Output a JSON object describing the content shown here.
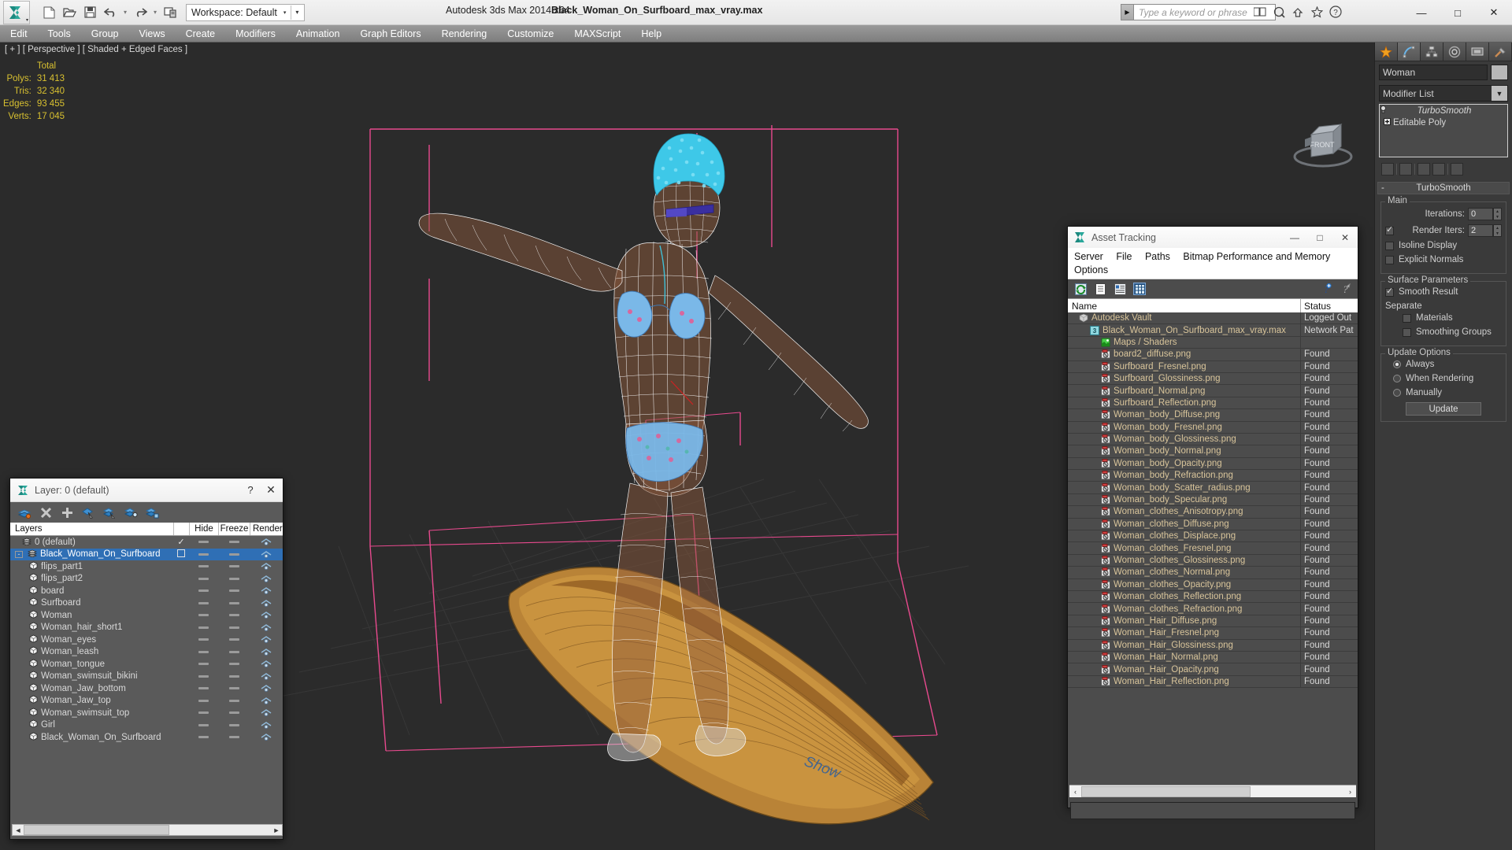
{
  "titlebar": {
    "app_title": "Autodesk 3ds Max  2014 x64",
    "file_title": "Black_Woman_On_Surfboard_max_vray.max",
    "workspace_label": "Workspace: Default",
    "search_placeholder": "Type a keyword or phrase",
    "quick_access": [
      {
        "name": "new-file-icon",
        "glyph": "⬜"
      },
      {
        "name": "open-file-icon",
        "glyph": "Ὄ2"
      },
      {
        "name": "save-file-icon",
        "glyph": "Ὃe"
      },
      {
        "name": "undo-icon",
        "glyph": "↶"
      },
      {
        "name": "redo-icon",
        "glyph": "↷"
      },
      {
        "name": "project-folder-icon",
        "glyph": "὜2"
      }
    ],
    "window_buttons": {
      "minimize": "—",
      "maximize": "□",
      "close": "✕"
    }
  },
  "menubar": {
    "items": [
      "Edit",
      "Tools",
      "Group",
      "Views",
      "Create",
      "Modifiers",
      "Animation",
      "Graph Editors",
      "Rendering",
      "Customize",
      "MAXScript",
      "Help"
    ]
  },
  "viewport": {
    "label": "[ + ] [ Perspective ] [ Shaded + Edged Faces ]",
    "stats_header": "Total",
    "stats": [
      {
        "label": "Polys:",
        "value": "31 413"
      },
      {
        "label": "Tris:",
        "value": "32 340"
      },
      {
        "label": "Edges:",
        "value": "93 455"
      },
      {
        "label": "Verts:",
        "value": "17 045"
      }
    ],
    "viewcube_face": "FRONT",
    "background_color": "#2b2b2b",
    "wireframe_color": "#ffffff",
    "helper_color": "#e84a8e",
    "surfboard_colors": [
      "#c8913f",
      "#a9702c",
      "#8d5a22"
    ],
    "skin_color": "#8d5a3c",
    "hair_color": "#36c8e8",
    "board_logo": "Show"
  },
  "command_panel": {
    "tabs": [
      {
        "name": "create-tab",
        "icon": "star-icon",
        "active": false
      },
      {
        "name": "modify-tab",
        "icon": "curve-icon",
        "active": true
      },
      {
        "name": "hierarchy-tab",
        "icon": "hierarchy-icon",
        "active": false
      },
      {
        "name": "motion-tab",
        "icon": "motion-icon",
        "active": false
      },
      {
        "name": "display-tab",
        "icon": "display-icon",
        "active": false
      },
      {
        "name": "utilities-tab",
        "icon": "hammer-icon",
        "active": false
      }
    ],
    "object_name": "Woman",
    "object_color": "#b8b8b8",
    "modifier_list_label": "Modifier List",
    "modifier_stack": [
      {
        "label": "TurboSmooth",
        "italic": true,
        "icon": "lightbulb-icon"
      },
      {
        "label": "Editable Poly",
        "italic": false,
        "icon": "plus-box-icon"
      }
    ],
    "rollout": {
      "title": "TurboSmooth",
      "minus": "-",
      "groups": [
        {
          "title": "Main",
          "fields": [
            {
              "type": "spinner",
              "label": "Iterations:",
              "value": "0"
            },
            {
              "type": "checkbox_spinner",
              "label": "Render Iters:",
              "value": "2",
              "checked": true
            },
            {
              "type": "checkbox",
              "label": "Isoline Display",
              "checked": false
            },
            {
              "type": "checkbox",
              "label": "Explicit Normals",
              "checked": false
            }
          ]
        },
        {
          "title": "Surface Parameters",
          "fields": [
            {
              "type": "checkbox",
              "label": "Smooth Result",
              "checked": true
            },
            {
              "type": "text",
              "label": "Separate"
            },
            {
              "type": "checkbox_indent",
              "label": "Materials",
              "checked": false
            },
            {
              "type": "checkbox_indent",
              "label": "Smoothing Groups",
              "checked": false
            }
          ]
        },
        {
          "title": "Update Options",
          "fields": [
            {
              "type": "radio",
              "label": "Always",
              "checked": true
            },
            {
              "type": "radio",
              "label": "When Rendering",
              "checked": false
            },
            {
              "type": "radio",
              "label": "Manually",
              "checked": false
            },
            {
              "type": "button",
              "label": "Update"
            }
          ]
        }
      ]
    }
  },
  "layer_dialog": {
    "title": "Layer: 0 (default)",
    "help_glyph": "?",
    "close_glyph": "✕",
    "toolbar_icons": [
      "create-new-layer-icon",
      "delete-layer-icon",
      "add-layer-icon",
      "select-objects-icon",
      "select-highlighted-icon",
      "highlight-selected-icon",
      "layer-properties-icon"
    ],
    "columns": [
      "Layers",
      "",
      "Hide",
      "Freeze",
      "Render"
    ],
    "rows": [
      {
        "label": "0 (default)",
        "indent": 1,
        "icon": "layer-icon",
        "selected": false,
        "check": true,
        "box": false
      },
      {
        "label": "Black_Woman_On_Surfboard",
        "indent": 0,
        "icon": "layer-icon",
        "selected": true,
        "check": false,
        "box": true,
        "expander": "-"
      },
      {
        "label": "flips_part1",
        "indent": 2,
        "icon": "object-icon",
        "selected": false
      },
      {
        "label": "flips_part2",
        "indent": 2,
        "icon": "object-icon",
        "selected": false
      },
      {
        "label": "board",
        "indent": 2,
        "icon": "object-icon",
        "selected": false
      },
      {
        "label": "Surfboard",
        "indent": 2,
        "icon": "object-icon",
        "selected": false
      },
      {
        "label": "Woman",
        "indent": 2,
        "icon": "object-icon",
        "selected": false
      },
      {
        "label": "Woman_hair_short1",
        "indent": 2,
        "icon": "object-icon",
        "selected": false
      },
      {
        "label": "Woman_eyes",
        "indent": 2,
        "icon": "object-icon",
        "selected": false
      },
      {
        "label": "Woman_leash",
        "indent": 2,
        "icon": "object-icon",
        "selected": false
      },
      {
        "label": "Woman_tongue",
        "indent": 2,
        "icon": "object-icon",
        "selected": false
      },
      {
        "label": "Woman_swimsuit_bikini",
        "indent": 2,
        "icon": "object-icon",
        "selected": false
      },
      {
        "label": "Woman_Jaw_bottom",
        "indent": 2,
        "icon": "object-icon",
        "selected": false
      },
      {
        "label": "Woman_Jaw_top",
        "indent": 2,
        "icon": "object-icon",
        "selected": false
      },
      {
        "label": "Woman_swimsuit_top",
        "indent": 2,
        "icon": "object-icon",
        "selected": false
      },
      {
        "label": "Girl",
        "indent": 2,
        "icon": "object-icon",
        "selected": false
      },
      {
        "label": "Black_Woman_On_Surfboard",
        "indent": 2,
        "icon": "object-icon",
        "selected": false
      }
    ]
  },
  "asset_tracking": {
    "title": "Asset Tracking",
    "window_buttons": {
      "minimize": "—",
      "maximize": "□",
      "close": "✕"
    },
    "menus": [
      "Server",
      "File",
      "Paths",
      "Bitmap Performance and Memory",
      "Options"
    ],
    "toolbar_icons": [
      "refresh-icon",
      "list-view-icon",
      "detail-view-icon",
      "grid-view-icon"
    ],
    "help_icons": [
      "help-new-icon",
      "help-icon"
    ],
    "columns": [
      "Name",
      "Status"
    ],
    "rows": [
      {
        "name": "Autodesk Vault",
        "status": "Logged Out",
        "level": 1,
        "icon": "vault-icon"
      },
      {
        "name": "Black_Woman_On_Surfboard_max_vray.max",
        "status": "Network Pat",
        "level": 2,
        "icon": "max-file-icon"
      },
      {
        "name": "Maps / Shaders",
        "status": "",
        "level": 3,
        "icon": "maps-icon"
      },
      {
        "name": "board2_diffuse.png",
        "status": "Found",
        "level": 3,
        "icon": "bitmap-icon"
      },
      {
        "name": "Surfboard_Fresnel.png",
        "status": "Found",
        "level": 3,
        "icon": "bitmap-icon"
      },
      {
        "name": "Surfboard_Glossiness.png",
        "status": "Found",
        "level": 3,
        "icon": "bitmap-icon"
      },
      {
        "name": "Surfboard_Normal.png",
        "status": "Found",
        "level": 3,
        "icon": "bitmap-icon"
      },
      {
        "name": "Surfboard_Reflection.png",
        "status": "Found",
        "level": 3,
        "icon": "bitmap-icon"
      },
      {
        "name": "Woman_body_Diffuse.png",
        "status": "Found",
        "level": 3,
        "icon": "bitmap-icon"
      },
      {
        "name": "Woman_body_Fresnel.png",
        "status": "Found",
        "level": 3,
        "icon": "bitmap-icon"
      },
      {
        "name": "Woman_body_Glossiness.png",
        "status": "Found",
        "level": 3,
        "icon": "bitmap-icon"
      },
      {
        "name": "Woman_body_Normal.png",
        "status": "Found",
        "level": 3,
        "icon": "bitmap-icon"
      },
      {
        "name": "Woman_body_Opacity.png",
        "status": "Found",
        "level": 3,
        "icon": "bitmap-icon"
      },
      {
        "name": "Woman_body_Refraction.png",
        "status": "Found",
        "level": 3,
        "icon": "bitmap-icon"
      },
      {
        "name": "Woman_body_Scatter_radius.png",
        "status": "Found",
        "level": 3,
        "icon": "bitmap-icon"
      },
      {
        "name": "Woman_body_Specular.png",
        "status": "Found",
        "level": 3,
        "icon": "bitmap-icon"
      },
      {
        "name": "Woman_clothes_Anisotropy.png",
        "status": "Found",
        "level": 3,
        "icon": "bitmap-icon"
      },
      {
        "name": "Woman_clothes_Diffuse.png",
        "status": "Found",
        "level": 3,
        "icon": "bitmap-icon"
      },
      {
        "name": "Woman_clothes_Displace.png",
        "status": "Found",
        "level": 3,
        "icon": "bitmap-icon"
      },
      {
        "name": "Woman_clothes_Fresnel.png",
        "status": "Found",
        "level": 3,
        "icon": "bitmap-icon"
      },
      {
        "name": "Woman_clothes_Glossiness.png",
        "status": "Found",
        "level": 3,
        "icon": "bitmap-icon"
      },
      {
        "name": "Woman_clothes_Normal.png",
        "status": "Found",
        "level": 3,
        "icon": "bitmap-icon"
      },
      {
        "name": "Woman_clothes_Opacity.png",
        "status": "Found",
        "level": 3,
        "icon": "bitmap-icon"
      },
      {
        "name": "Woman_clothes_Reflection.png",
        "status": "Found",
        "level": 3,
        "icon": "bitmap-icon"
      },
      {
        "name": "Woman_clothes_Refraction.png",
        "status": "Found",
        "level": 3,
        "icon": "bitmap-icon"
      },
      {
        "name": "Woman_Hair_Diffuse.png",
        "status": "Found",
        "level": 3,
        "icon": "bitmap-icon"
      },
      {
        "name": "Woman_Hair_Fresnel.png",
        "status": "Found",
        "level": 3,
        "icon": "bitmap-icon"
      },
      {
        "name": "Woman_Hair_Glossiness.png",
        "status": "Found",
        "level": 3,
        "icon": "bitmap-icon"
      },
      {
        "name": "Woman_Hair_Normal.png",
        "status": "Found",
        "level": 3,
        "icon": "bitmap-icon"
      },
      {
        "name": "Woman_Hair_Opacity.png",
        "status": "Found",
        "level": 3,
        "icon": "bitmap-icon"
      },
      {
        "name": "Woman_Hair_Reflection.png",
        "status": "Found",
        "level": 3,
        "icon": "bitmap-icon"
      }
    ],
    "scroll_left": "‹",
    "scroll_right": "›",
    "status_text": ""
  }
}
